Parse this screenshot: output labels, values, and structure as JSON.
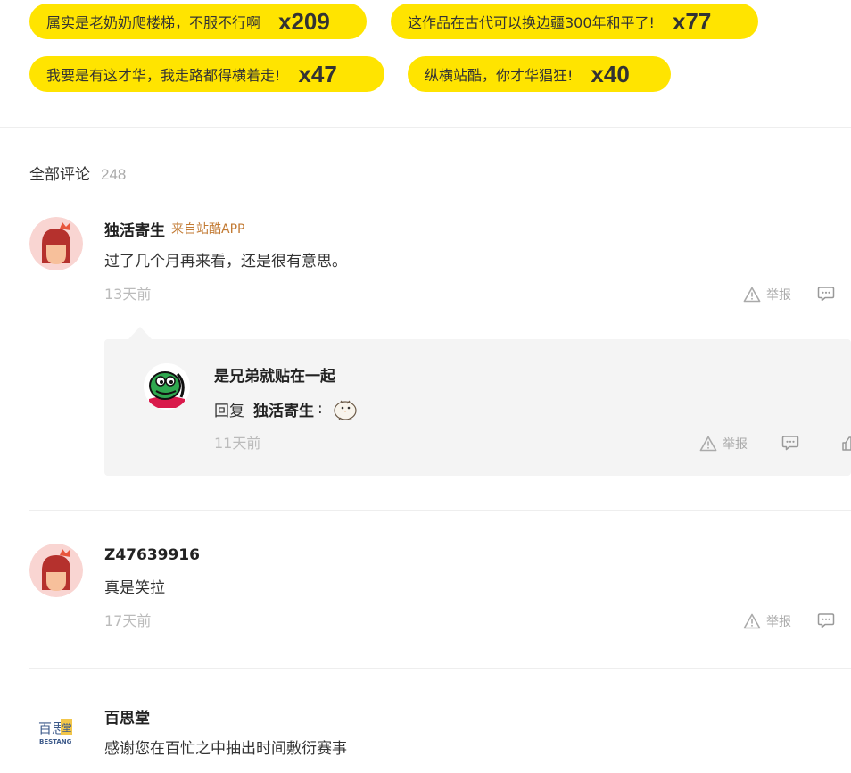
{
  "reactions": [
    {
      "text": "属实是老奶奶爬楼梯，不服不行啊",
      "count": "x209"
    },
    {
      "text": "这作品在古代可以换边疆300年和平了!",
      "count": "x77"
    },
    {
      "text": "我要是有这才华，我走路都得横着走!",
      "count": "x47"
    },
    {
      "text": "纵横站酷，你才华猖狂!",
      "count": "x40"
    }
  ],
  "comments_header": {
    "title": "全部评论",
    "count": "248"
  },
  "comments": [
    {
      "username": "独活寄生",
      "source": "来自站酷APP",
      "text": "过了几个月再来看，还是很有意思。",
      "time": "13天前",
      "report_label": "举报",
      "reply": {
        "username": "是兄弟就贴在一起",
        "prefix": "回复",
        "target": "独活寄生",
        "colon": ":",
        "time": "11天前",
        "report_label": "举报"
      }
    },
    {
      "username": "Z47639916",
      "text": "真是笑拉",
      "time": "17天前",
      "report_label": "举报"
    },
    {
      "username": "百思堂",
      "text": "感谢您在百忙之中抽出时间敷衍赛事",
      "avatar_logo_text": "BESTANG"
    }
  ],
  "colors": {
    "chip_bg": "#ffe400",
    "source_tag": "#c27a33",
    "meta_text": "#bbbbbb",
    "reply_bg": "#f4f4f4"
  },
  "icons": [
    "warning-icon",
    "comment-icon",
    "like-icon"
  ]
}
